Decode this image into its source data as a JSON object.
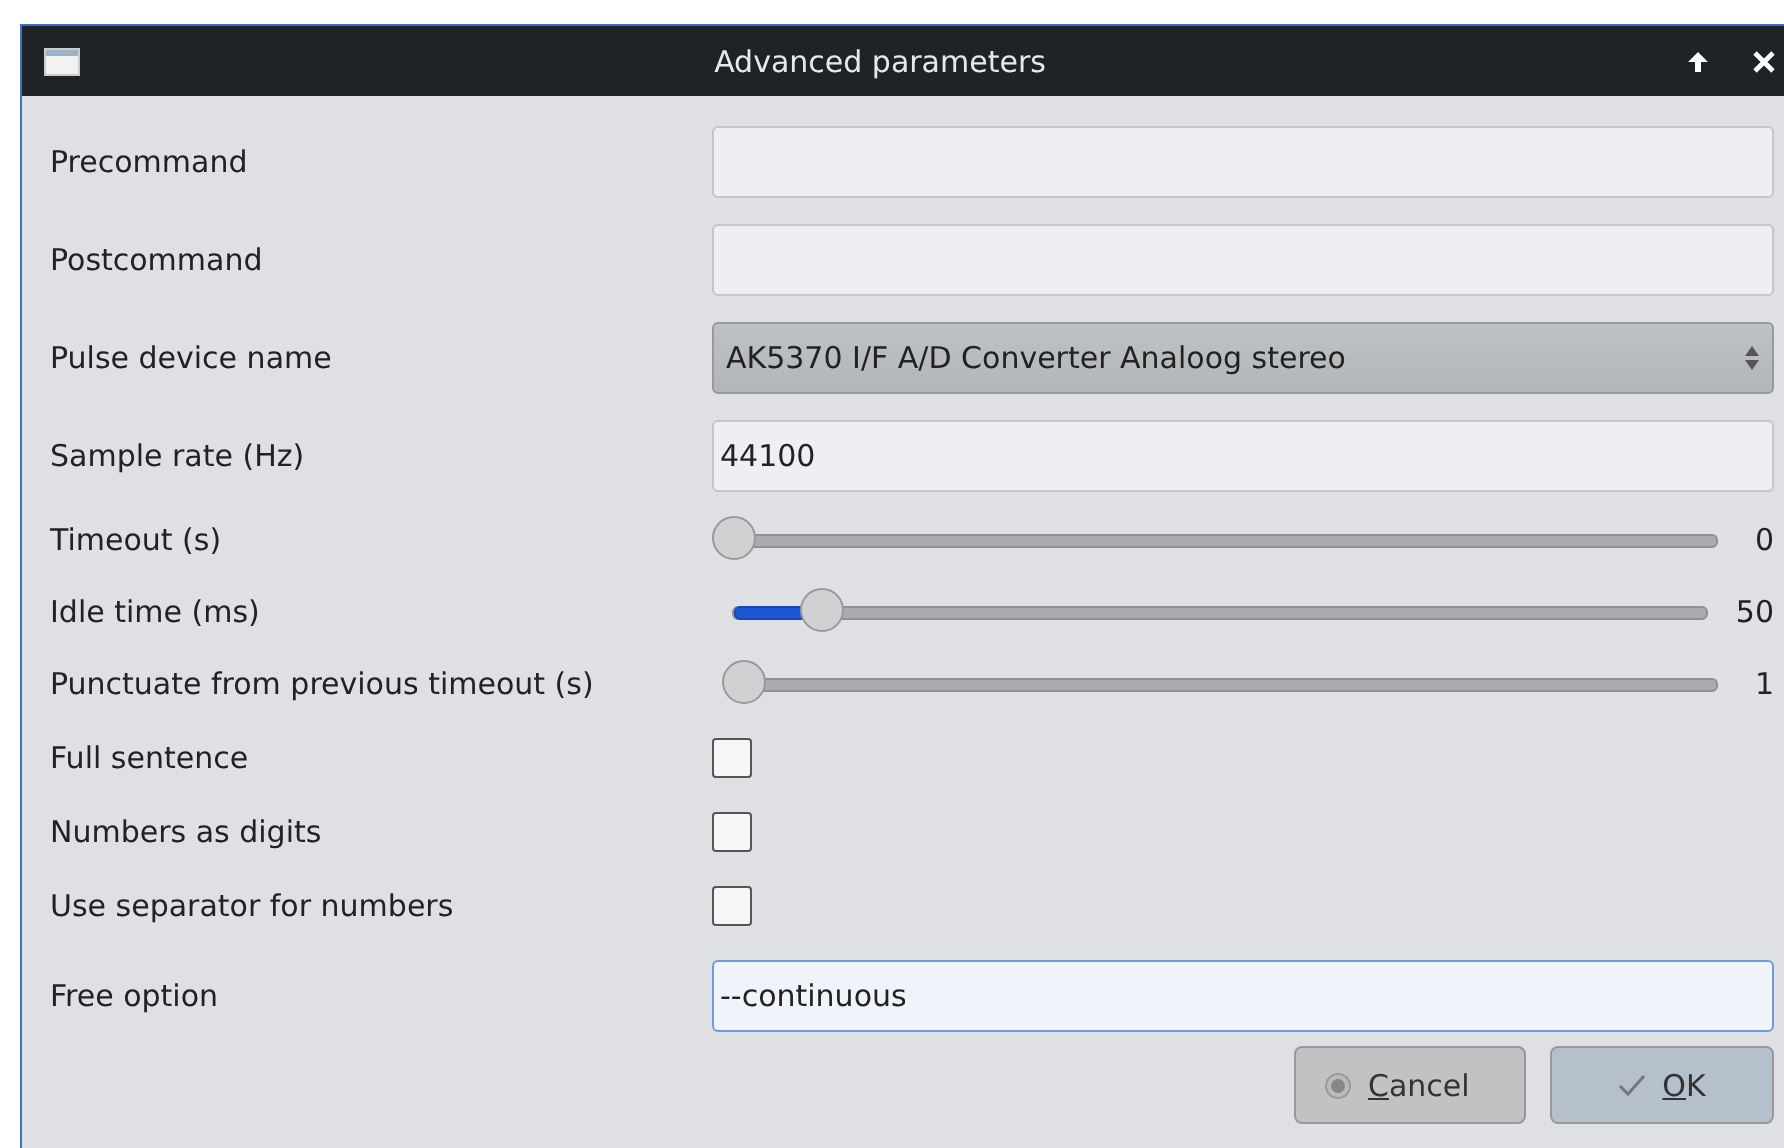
{
  "window": {
    "title": "Advanced parameters"
  },
  "fields": [
    {
      "kind": "text",
      "label": "Precommand",
      "focused": false
    },
    {
      "kind": "text",
      "label": "Postcommand",
      "focused": false
    },
    {
      "kind": "combo",
      "label": "Pulse device name",
      "value": "AK5370 I/F A/D Converter Analoog stereo"
    },
    {
      "kind": "text",
      "label": "Sample rate (Hz)",
      "value": "44100",
      "focused": false
    },
    {
      "kind": "slider",
      "label": "Timeout (s)",
      "level": 0,
      "reading": "0"
    },
    {
      "kind": "slider",
      "label": "Idle time (ms)",
      "level": 0.09,
      "reading": "50"
    },
    {
      "kind": "slider",
      "label": "Punctuate from previous timeout (s)",
      "level": 0.01,
      "reading": "1"
    },
    {
      "kind": "checkbox",
      "label": "Full sentence",
      "checked": false
    },
    {
      "kind": "checkbox",
      "label": "Numbers as digits",
      "checked": false
    },
    {
      "kind": "checkbox",
      "label": "Use separator for numbers",
      "checked": false
    },
    {
      "kind": "text",
      "label": "Free option",
      "value": "--continuous",
      "focused": true
    }
  ],
  "buttons": [
    {
      "kind": "cancel",
      "label": "Cancel",
      "default": false
    },
    {
      "kind": "ok",
      "label": "OK",
      "default": true
    }
  ]
}
